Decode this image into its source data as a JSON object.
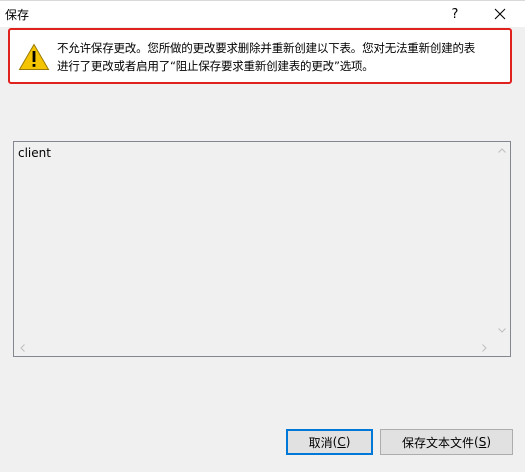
{
  "window": {
    "title": "保存",
    "help_label": "?"
  },
  "warning": {
    "icon": "warning-icon",
    "line1": "不允许保存更改。您所做的更改要求删除并重新创建以下表。您对无法重新创建的表",
    "line2": "进行了更改或者启用了“阻止保存要求重新创建表的更改”选项。"
  },
  "list": {
    "items": [
      "client"
    ]
  },
  "buttons": {
    "cancel_label": "取消",
    "cancel_prefix": "(",
    "cancel_accel": "C",
    "cancel_suffix": ")",
    "save_label": "保存文本文件",
    "save_prefix": "(",
    "save_accel": "S",
    "save_suffix": ")"
  },
  "colors": {
    "warning_border": "#e0221e",
    "warning_icon_fill": "#f5c400",
    "default_button_border": "#0078d7"
  }
}
